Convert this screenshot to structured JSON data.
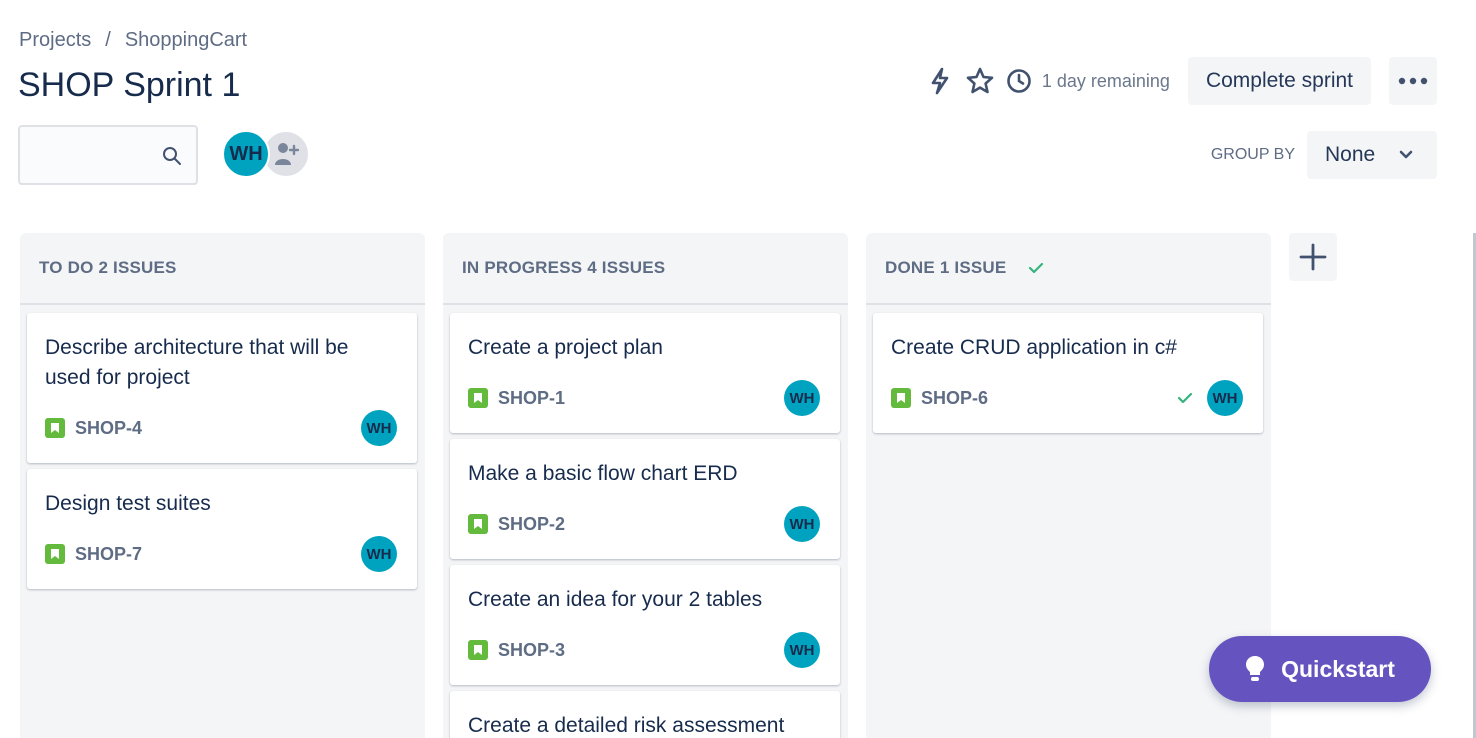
{
  "breadcrumb": {
    "project": "Projects",
    "separator": "/",
    "name": "ShoppingCart"
  },
  "page_title": "SHOP Sprint 1",
  "header": {
    "remaining": "1 day remaining",
    "complete_label": "Complete sprint",
    "icons": [
      "automation-icon",
      "star-icon",
      "clock-icon",
      "more-icon"
    ]
  },
  "search": {
    "placeholder": ""
  },
  "people": {
    "avatar_initials": "WH",
    "add_icon": "add-people-icon"
  },
  "group_by": {
    "label": "GROUP BY",
    "value": "None"
  },
  "columns": [
    {
      "title": "TO DO 2 ISSUES",
      "done": false,
      "cards": [
        {
          "title": "Describe architecture that will be used for project",
          "key": "SHOP-4",
          "assignee": "WH"
        },
        {
          "title": "Design test suites",
          "key": "SHOP-7",
          "assignee": "WH"
        }
      ]
    },
    {
      "title": "IN PROGRESS 4 ISSUES",
      "done": false,
      "cards": [
        {
          "title": "Create a project plan",
          "key": "SHOP-1",
          "assignee": "WH"
        },
        {
          "title": "Make a basic flow chart ERD",
          "key": "SHOP-2",
          "assignee": "WH"
        },
        {
          "title": "Create an idea for your 2 tables",
          "key": "SHOP-3",
          "assignee": "WH"
        },
        {
          "title": "Create a detailed risk assessment"
        }
      ]
    },
    {
      "title": "DONE 1 ISSUE",
      "done": true,
      "cards": [
        {
          "title": "Create CRUD application in c#",
          "key": "SHOP-6",
          "assignee": "WH",
          "done": true
        }
      ]
    }
  ],
  "quickstart_label": "Quickstart",
  "colors": {
    "accent": "#6554C0",
    "avatar": "#00A3BF",
    "story": "#63BA3C",
    "done": "#36B37E"
  }
}
